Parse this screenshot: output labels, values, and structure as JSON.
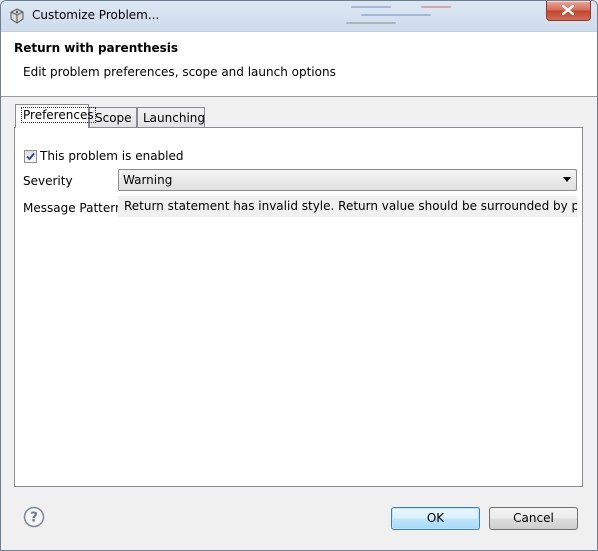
{
  "window": {
    "title": "Customize Problem...",
    "icon": "gear-cube-icon"
  },
  "header": {
    "title": "Return with parenthesis",
    "description": "Edit problem preferences, scope and launch options"
  },
  "tabs": [
    {
      "label": "Preferences",
      "active": true
    },
    {
      "label": "Scope",
      "active": false
    },
    {
      "label": "Launching",
      "active": false
    }
  ],
  "preferences": {
    "enabled_label": "This problem is enabled",
    "enabled": true,
    "severity_label": "Severity",
    "severity_value": "Warning",
    "pattern_label": "Message Pattern",
    "pattern_value": "Return statement has invalid style. Return value should be surrounded by parenthesis"
  },
  "footer": {
    "help_icon": "help-icon",
    "ok_label": "OK",
    "cancel_label": "Cancel"
  },
  "colors": {
    "titlebar": "#cfdced",
    "close_button": "#c4432c",
    "default_button_border": "#3c7fb1"
  }
}
